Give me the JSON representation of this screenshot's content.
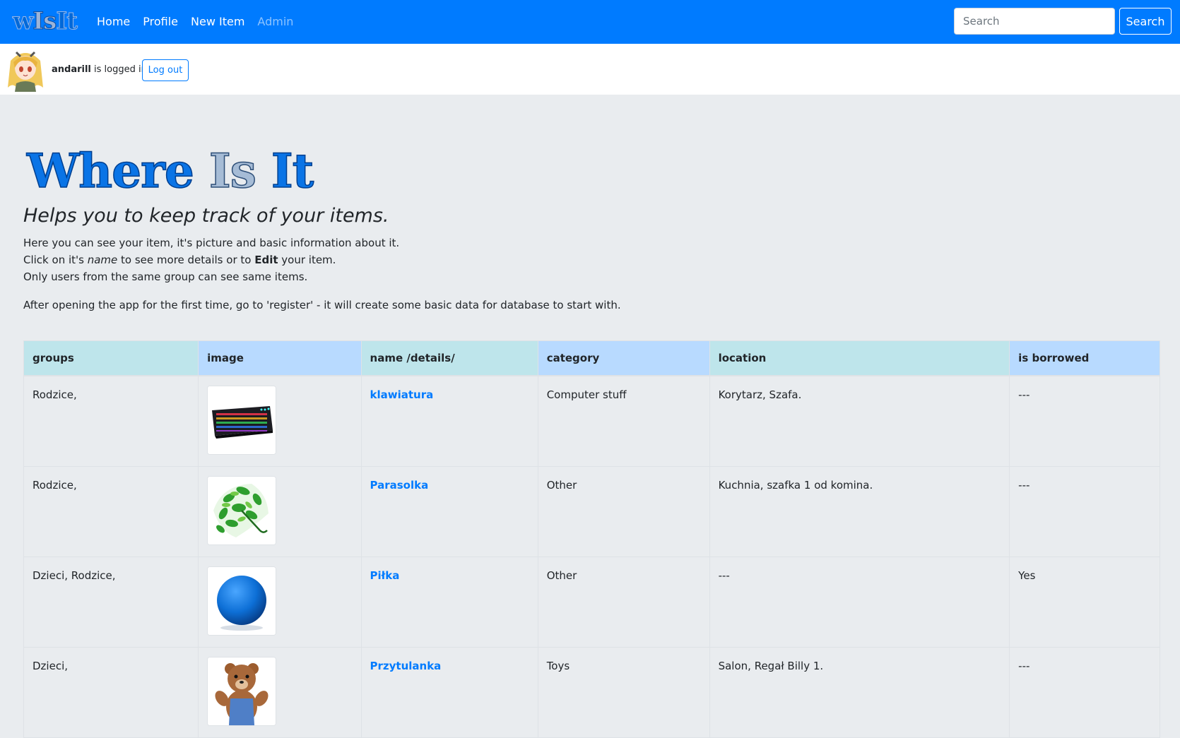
{
  "navbar": {
    "brand": {
      "w": "w",
      "is": "Is",
      "it": "It"
    },
    "links": [
      {
        "label": "Home"
      },
      {
        "label": "Profile"
      },
      {
        "label": "New Item"
      },
      {
        "label": "Admin"
      }
    ],
    "search_placeholder": "Search",
    "search_button": "Search",
    "colors": {
      "primary": "#007bff"
    }
  },
  "userbar": {
    "username": "andarill",
    "status_text": " is logged in.",
    "logout_label": "Log out"
  },
  "hero": {
    "title_where": "Where",
    "title_is": "Is",
    "title_it": "It",
    "lead": "Helps you to keep track of your items.",
    "line1": "Here you can see your item, it's picture and basic information about it.",
    "line2_a": "Click on it's ",
    "line2_name": "name",
    "line2_b": " to see more details or to ",
    "line2_edit": "Edit",
    "line2_c": " your item.",
    "line3": "Only users from the same group can see same items.",
    "line4": "After opening the app for the first time, go to 'register' - it will create some basic data for database to start with."
  },
  "table": {
    "headers": [
      "groups",
      "image",
      "name /details/",
      "category",
      "location",
      "is borrowed"
    ],
    "rows": [
      {
        "groups": "Rodzice,",
        "image": "keyboard-image",
        "name": "klawiatura",
        "category": "Computer stuff",
        "location": "Korytarz, Szafa.",
        "borrowed": "---"
      },
      {
        "groups": "Rodzice,",
        "image": "umbrella-image",
        "name": "Parasolka",
        "category": "Other",
        "location": "Kuchnia, szafka 1 od komina.",
        "borrowed": "---"
      },
      {
        "groups": "Dzieci, Rodzice,",
        "image": "ball-image",
        "name": "Piłka",
        "category": "Other",
        "location": "---",
        "borrowed": "Yes"
      },
      {
        "groups": "Dzieci,",
        "image": "teddy-bear-image",
        "name": "Przytulanka",
        "category": "Toys",
        "location": "Salon, Regał Billy 1.",
        "borrowed": "---"
      }
    ]
  }
}
